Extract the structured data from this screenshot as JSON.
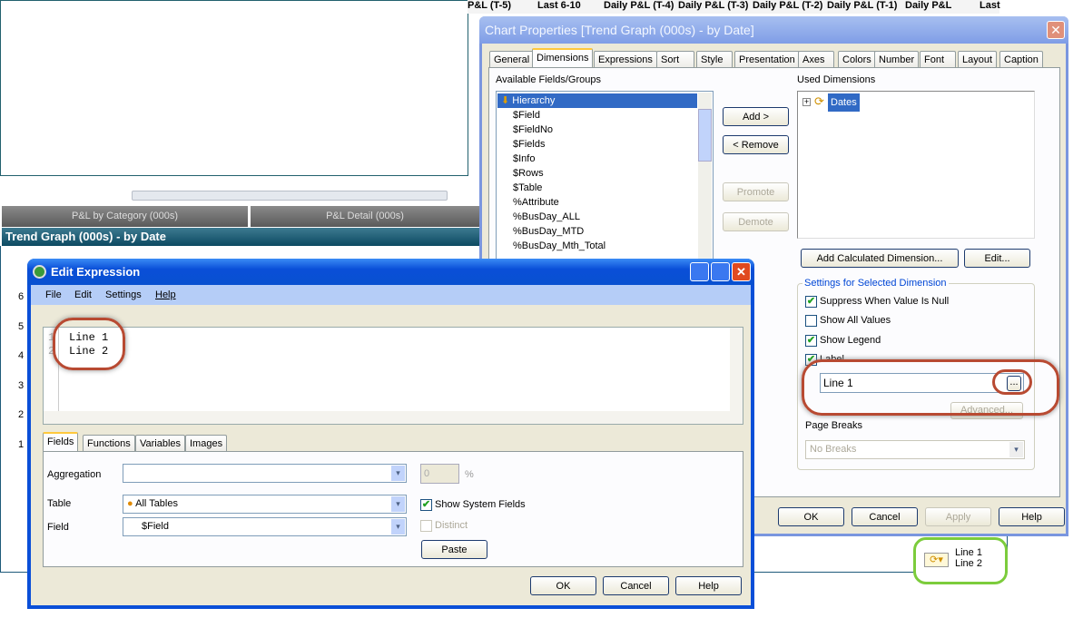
{
  "background": {
    "column_headers": [
      "P&L (T-5)",
      "Last 6-10",
      "Daily P&L (T-4)",
      "Daily P&L (T-3)",
      "Daily P&L (T-2)",
      "Daily P&L (T-1)",
      "Daily P&L",
      "Last"
    ],
    "sheet_tabs": [
      "P&L by Category (000s)",
      "P&L Detail (000s)"
    ],
    "chart_title": "Trend Graph (000s) - by Date",
    "y_ticks": [
      "6",
      "5",
      "4",
      "3",
      "2",
      "1"
    ],
    "legend": {
      "items": [
        "Line 1",
        "Line 2"
      ]
    }
  },
  "chart_props": {
    "title": "Chart Properties [Trend Graph (000s) - by Date]",
    "tabs": [
      "General",
      "Dimensions",
      "Expressions",
      "Sort",
      "Style",
      "Presentation",
      "Axes",
      "Colors",
      "Number",
      "Font",
      "Layout",
      "Caption"
    ],
    "available_label": "Available Fields/Groups",
    "available_fields": [
      "Hierarchy",
      "$Field",
      "$FieldNo",
      "$Fields",
      "$Info",
      "$Rows",
      "$Table",
      "%Attribute",
      "%BusDay_ALL",
      "%BusDay_MTD",
      "%BusDay_Mth_Total"
    ],
    "used_label": "Used Dimensions",
    "used_dimensions": [
      "Dates"
    ],
    "add": "Add >",
    "remove": "< Remove",
    "promote": "Promote",
    "demote": "Demote",
    "add_calc": "Add Calculated Dimension...",
    "edit": "Edit...",
    "settings_title": "Settings for Selected Dimension",
    "suppress": "Suppress When Value Is Null",
    "show_all": "Show All Values",
    "show_legend": "Show Legend",
    "label": "Label",
    "label_value": "Line 1",
    "ellipsis": "...",
    "advanced": "Advanced...",
    "page_breaks": "Page Breaks",
    "page_breaks_value": "No Breaks",
    "ok": "OK",
    "cancel": "Cancel",
    "apply": "Apply",
    "help": "Help"
  },
  "edit_expr": {
    "title": "Edit Expression",
    "menu": [
      "File",
      "Edit",
      "Settings",
      "Help"
    ],
    "line_numbers": [
      "1",
      "2"
    ],
    "lines": [
      "Line 1",
      "Line 2"
    ],
    "tabs": [
      "Fields",
      "Functions",
      "Variables",
      "Images"
    ],
    "aggregation_label": "Aggregation",
    "aggregation_value": "",
    "percent_value": "0",
    "percent_sign": "%",
    "table_label": "Table",
    "table_value": "All Tables",
    "field_label": "Field",
    "field_value": "$Field",
    "show_system": "Show System Fields",
    "distinct": "Distinct",
    "paste": "Paste",
    "ok": "OK",
    "cancel": "Cancel",
    "help": "Help"
  }
}
